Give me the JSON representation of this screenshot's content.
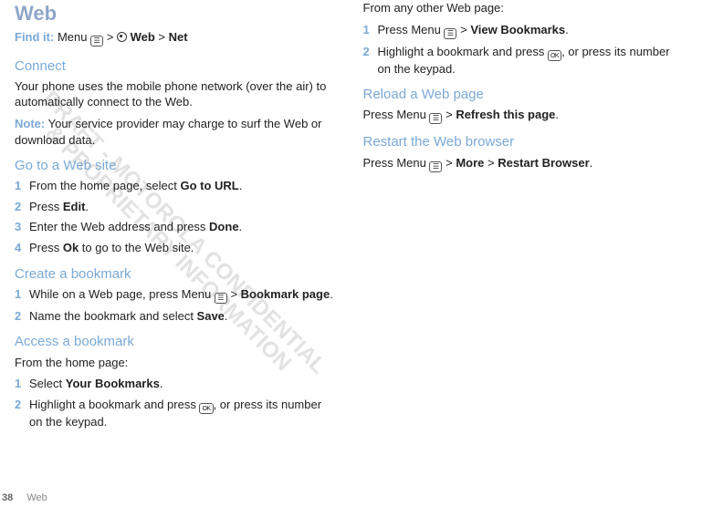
{
  "watermark": "DRAFT - MOTOROLA CONFIDENTIAL\n& PROPRIETARY INFORMATION",
  "title": "Web",
  "findit": {
    "label": "Find it:",
    "pre": "Menu",
    "mid": "Web",
    "post": "Net"
  },
  "left": {
    "connect": {
      "heading": "Connect",
      "p1": "Your phone uses the mobile phone network (over the air) to automatically connect to the Web.",
      "noteLabel": "Note:",
      "noteText": "Your service provider may charge to surf the Web or download data."
    },
    "goto": {
      "heading": "Go to a Web site",
      "steps": [
        {
          "n": "1",
          "pre": "From the home page, select ",
          "b": "Go to URL",
          "post": "."
        },
        {
          "n": "2",
          "pre": "Press ",
          "b": "Edit",
          "post": "."
        },
        {
          "n": "3",
          "pre": "Enter the Web address and press ",
          "b": "Done",
          "post": "."
        },
        {
          "n": "4",
          "pre": "Press ",
          "b": "Ok",
          "post": " to go to the Web site."
        }
      ]
    },
    "create": {
      "heading": "Create a bookmark",
      "steps": [
        {
          "n": "1",
          "pre": "While on a Web page, press Menu ",
          "icon": "menu",
          "mid": " > ",
          "b": "Bookmark page",
          "post": "."
        },
        {
          "n": "2",
          "pre": "Name the bookmark and select ",
          "b": "Save",
          "post": "."
        }
      ]
    },
    "access": {
      "heading": "Access a bookmark",
      "intro": "From the home page:",
      "steps": [
        {
          "n": "1",
          "pre": "Select ",
          "b": "Your Bookmarks",
          "post": "."
        },
        {
          "n": "2",
          "pre": "Highlight a bookmark and press ",
          "icon": "ok",
          "post": ", or press its number on the keypad."
        }
      ]
    }
  },
  "right": {
    "otherIntro": "From any other Web page:",
    "otherSteps": [
      {
        "n": "1",
        "pre": " Press Menu ",
        "icon": "menu",
        "mid": " > ",
        "b": "View Bookmarks",
        "post": "."
      },
      {
        "n": "2",
        "pre": "Highlight a bookmark and press ",
        "icon": "ok",
        "post": ", or press its number on the keypad."
      }
    ],
    "reload": {
      "heading": "Reload a Web page",
      "pre": "Press Menu ",
      "mid": " > ",
      "b": "Refresh this page",
      "post": "."
    },
    "restart": {
      "heading": "Restart the Web browser",
      "pre": "Press Menu ",
      "mid": " > ",
      "b1": "More",
      "mid2": " > ",
      "b2": "Restart Browser",
      "post": "."
    }
  },
  "footer": {
    "page": "38",
    "section": "Web"
  }
}
